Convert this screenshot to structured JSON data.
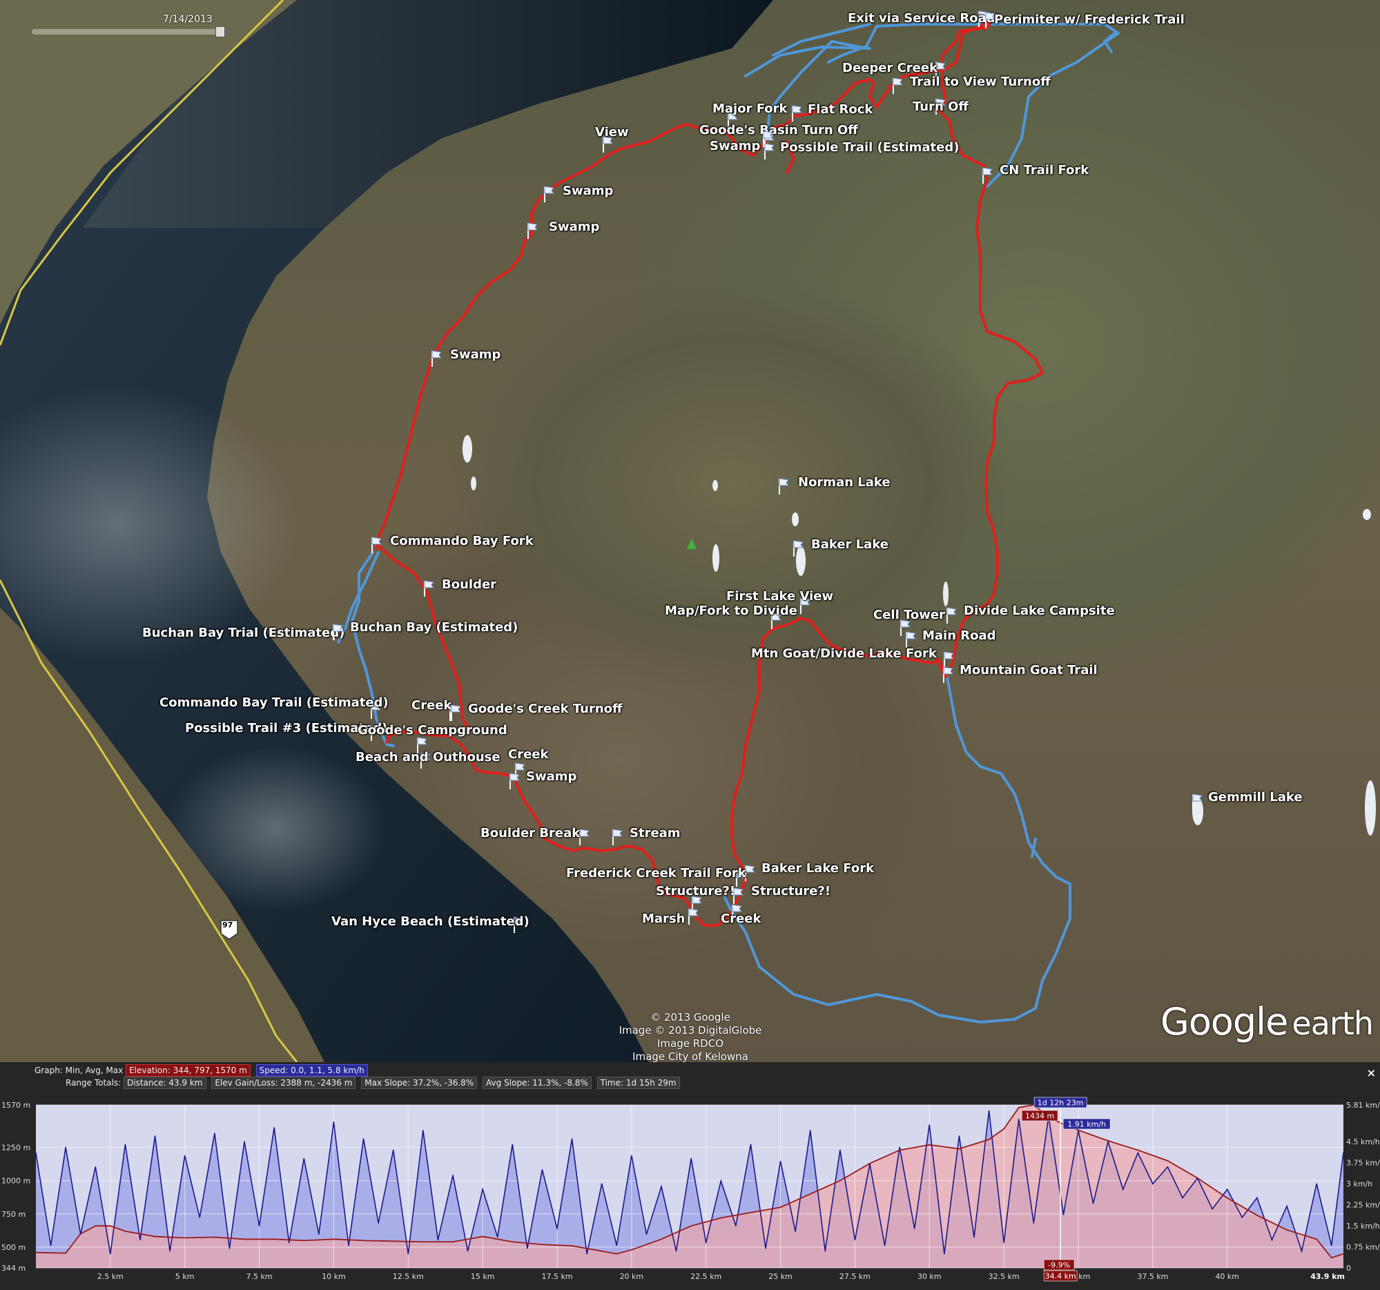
{
  "time_slider": {
    "date": "7/14/2013"
  },
  "map": {
    "waypoints": [
      {
        "name": "Exit via Service Road"
      },
      {
        "name": "Perimiter w/ Frederick Trail"
      },
      {
        "name": "Deeper Creek"
      },
      {
        "name": "Trail to View Turnoff"
      },
      {
        "name": "Turn Off"
      },
      {
        "name": "Major Fork"
      },
      {
        "name": "Flat Rock"
      },
      {
        "name": "Goode's Basin Turn Off"
      },
      {
        "name": "Swamp"
      },
      {
        "name": "Possible Trail (Estimated)"
      },
      {
        "name": "View"
      },
      {
        "name": "CN Trail Fork"
      },
      {
        "name": "Swamp"
      },
      {
        "name": "Swamp"
      },
      {
        "name": "Swamp"
      },
      {
        "name": "Norman Lake"
      },
      {
        "name": "Baker Lake"
      },
      {
        "name": "Commando Bay Fork"
      },
      {
        "name": "Boulder"
      },
      {
        "name": "First Lake View"
      },
      {
        "name": "Map/Fork to Divide"
      },
      {
        "name": "Cell Tower"
      },
      {
        "name": "Divide Lake Campsite"
      },
      {
        "name": "Main Road"
      },
      {
        "name": "Mtn Goat/Divide Lake Fork"
      },
      {
        "name": "Mountain Goat Trail"
      },
      {
        "name": "Buchan Bay Trial (Estimated)"
      },
      {
        "name": "Buchan Bay (Estimated)"
      },
      {
        "name": "Commando Bay Trail (Estimated)"
      },
      {
        "name": "Creek"
      },
      {
        "name": "Goode's Creek Turnoff"
      },
      {
        "name": "Possible Trail #3 (Estimated)"
      },
      {
        "name": "Goode's Campground"
      },
      {
        "name": "Beach and Outhouse"
      },
      {
        "name": "Creek"
      },
      {
        "name": "Swamp"
      },
      {
        "name": "Gemmill Lake"
      },
      {
        "name": "Boulder Break"
      },
      {
        "name": "Stream"
      },
      {
        "name": "Baker Lake Fork"
      },
      {
        "name": "Frederick Creek Trail Fork"
      },
      {
        "name": "Structure?!"
      },
      {
        "name": "Structure?!"
      },
      {
        "name": "Marsh"
      },
      {
        "name": "Creek"
      },
      {
        "name": "Van Hyce Beach (Estimated)"
      }
    ],
    "highway_shield": "97",
    "route_colors": {
      "recorded": "#e0201c",
      "estimated": "#4f97d9"
    },
    "credits": [
      "© 2013 Google",
      "Image © 2013 DigitalGlobe",
      "Image RDCO",
      "Image City of Kelowna"
    ],
    "logo": {
      "word1": "Google",
      "word2": "earth"
    }
  },
  "profile_panel": {
    "graph_label": "Graph: Min, Avg, Max",
    "elevation_stat": "Elevation: 344, 797, 1570 m",
    "speed_stat": "Speed: 0.0, 1.1, 5.8 km/h",
    "range_label": "Range Totals:",
    "distance_stat": "Distance: 43.9 km",
    "gain_stat": "Elev Gain/Loss: 2388 m, -2436 m",
    "max_slope_stat": "Max Slope: 37.2%, -36.8%",
    "avg_slope_stat": "Avg Slope: 11.3%, -8.8%",
    "time_stat": "Time: 1d 15h 29m",
    "close": "×",
    "cursor": {
      "time": "1d 12h 23m",
      "elevation": "1434 m",
      "speed": "1.91 km/h",
      "slope": "-9.9%",
      "distance": "34.4 km",
      "distance_km": 34.4
    },
    "end_label": "43.9 km"
  },
  "chart_data": {
    "type": "area",
    "title": "",
    "xlabel": "",
    "ylabel": "",
    "x_ticks": [
      "2.5 km",
      "5 km",
      "7.5 km",
      "10 km",
      "12.5 km",
      "15 km",
      "17.5 km",
      "20 km",
      "22.5 km",
      "25 km",
      "27.5 km",
      "30 km",
      "32.5 km",
      "35 km",
      "37.5 km",
      "40 km"
    ],
    "y_left_ticks": [
      "1570 m",
      "1250 m",
      "1000 m",
      "750 m",
      "500 m",
      "344 m"
    ],
    "y_right_ticks": [
      "5.81 km/h",
      "4.5 km/h",
      "3.75 km/h",
      "3 km/h",
      "2.25 km/h",
      "1.5 km/h",
      "0.75 km/h",
      "0"
    ],
    "xlim": [
      0,
      43.9
    ],
    "ylim_elevation": [
      344,
      1570
    ],
    "ylim_speed": [
      0,
      5.81
    ],
    "series": [
      {
        "name": "Elevation",
        "color": "#9b1b1b",
        "x": [
          0,
          1,
          1.5,
          2,
          2.5,
          3,
          4,
          5,
          6,
          7,
          8,
          9,
          10,
          11,
          12,
          13,
          14,
          14.5,
          15,
          15.5,
          16,
          17,
          18,
          19,
          19.5,
          20,
          21,
          22,
          23,
          24,
          25,
          26,
          27,
          28,
          29,
          30,
          31,
          32,
          32.5,
          33,
          33.5,
          34,
          34.4,
          35,
          36,
          37,
          38,
          39,
          40,
          41,
          42,
          43,
          43.5,
          43.9
        ],
        "values": [
          460,
          455,
          600,
          660,
          660,
          620,
          580,
          570,
          575,
          560,
          560,
          550,
          560,
          550,
          545,
          540,
          540,
          560,
          580,
          560,
          540,
          520,
          510,
          470,
          450,
          480,
          560,
          660,
          720,
          760,
          800,
          900,
          1000,
          1130,
          1230,
          1270,
          1240,
          1310,
          1390,
          1550,
          1570,
          1480,
          1434,
          1380,
          1300,
          1230,
          1150,
          1020,
          870,
          740,
          630,
          560,
          420,
          450
        ]
      },
      {
        "name": "Speed",
        "color": "#1a1a8a",
        "x": [
          0,
          0.5,
          1,
          1.5,
          2,
          2.5,
          3,
          3.5,
          4,
          4.5,
          5,
          5.5,
          6,
          6.5,
          7,
          7.5,
          8,
          8.5,
          9,
          9.5,
          10,
          10.5,
          11,
          11.5,
          12,
          12.5,
          13,
          13.5,
          14,
          14.5,
          15,
          15.5,
          16,
          16.5,
          17,
          17.5,
          18,
          18.5,
          19,
          19.5,
          20,
          20.5,
          21,
          21.5,
          22,
          22.5,
          23,
          23.5,
          24,
          24.5,
          25,
          25.5,
          26,
          26.5,
          27,
          27.5,
          28,
          28.5,
          29,
          29.5,
          30,
          30.5,
          31,
          31.5,
          32,
          32.5,
          33,
          33.5,
          34,
          34.5,
          35,
          35.5,
          36,
          36.5,
          37,
          37.5,
          38,
          38.5,
          39,
          39.5,
          40,
          40.5,
          41,
          41.5,
          42,
          42.5,
          43,
          43.5,
          43.9
        ],
        "values": [
          4.1,
          0.8,
          4.3,
          1.2,
          3.6,
          0.5,
          4.4,
          1.0,
          4.7,
          0.6,
          4.0,
          1.8,
          4.8,
          0.7,
          4.5,
          1.5,
          5.0,
          0.9,
          3.9,
          1.2,
          5.2,
          0.8,
          4.6,
          1.6,
          4.2,
          0.5,
          4.9,
          1.0,
          3.3,
          0.6,
          2.8,
          1.1,
          4.4,
          0.7,
          3.5,
          1.4,
          4.6,
          0.5,
          3.0,
          0.8,
          4.0,
          1.2,
          2.9,
          0.6,
          3.9,
          0.9,
          3.1,
          1.5,
          4.4,
          0.7,
          3.8,
          1.3,
          4.9,
          0.6,
          4.2,
          1.0,
          3.7,
          0.8,
          4.3,
          1.4,
          5.1,
          0.5,
          4.7,
          1.1,
          5.6,
          0.9,
          5.3,
          1.6,
          5.4,
          1.9,
          4.9,
          2.3,
          4.5,
          2.8,
          4.1,
          3.0,
          3.6,
          2.5,
          3.2,
          2.1,
          2.8,
          1.8,
          2.5,
          1.0,
          2.2,
          0.6,
          3.0,
          0.8,
          4.1
        ]
      }
    ]
  }
}
